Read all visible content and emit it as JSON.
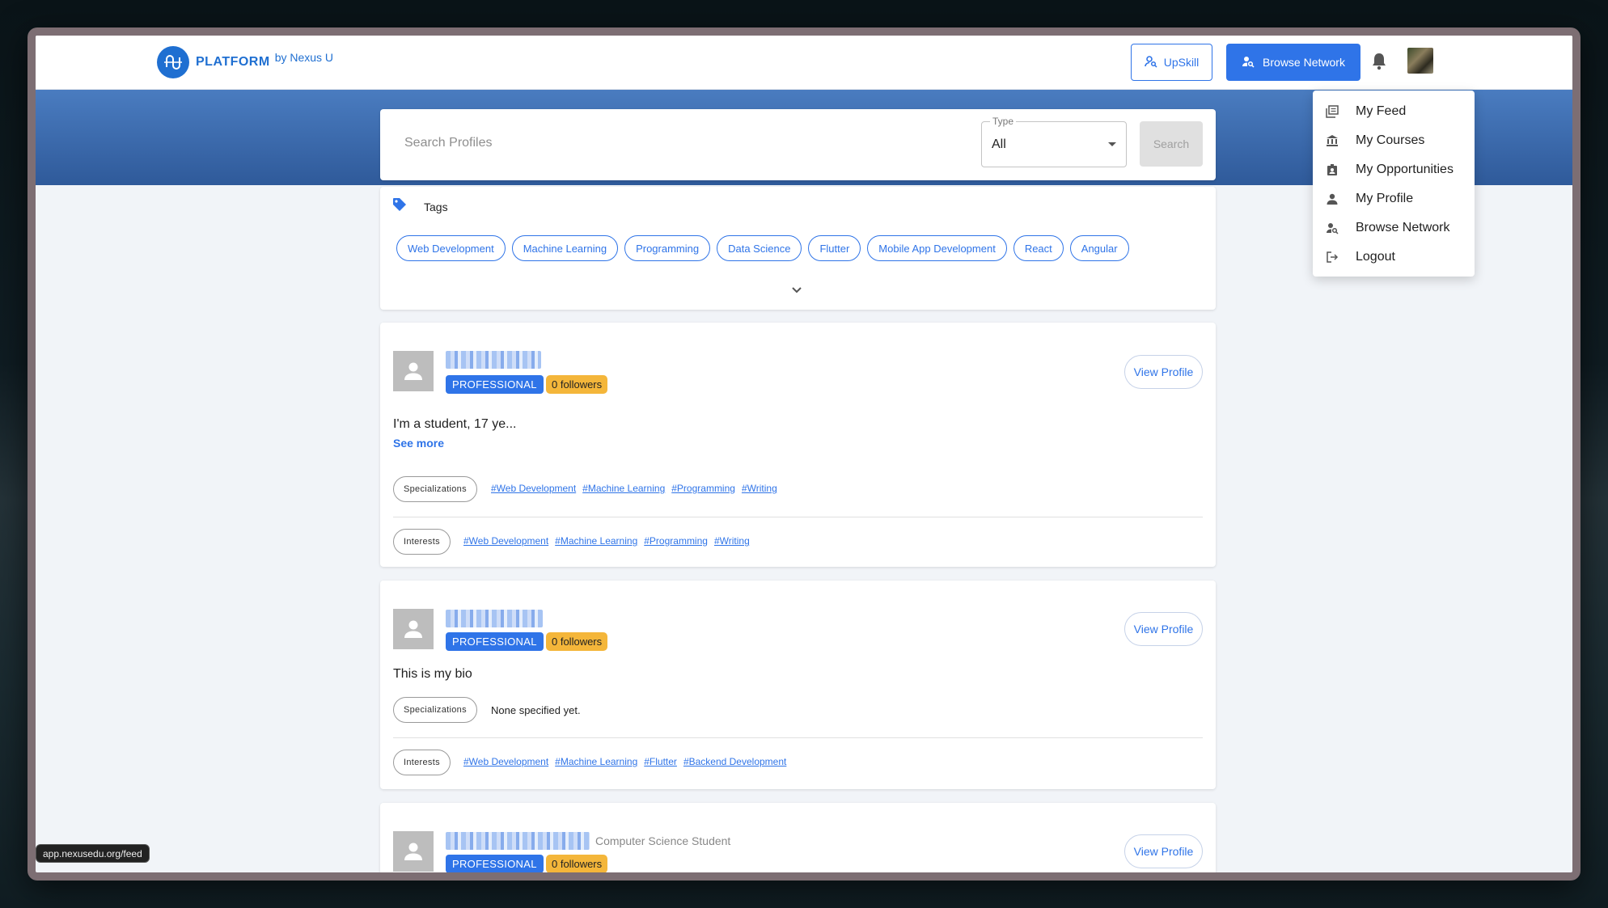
{
  "nav": {
    "logo_text": "PLATFORM",
    "logo_sub": "by Nexus U",
    "upskill_label": "UpSkill",
    "browse_label": "Browse Network"
  },
  "search": {
    "placeholder": "Search Profiles",
    "type_label": "Type",
    "type_value": "All",
    "search_button": "Search"
  },
  "tags": {
    "title": "Tags",
    "items": [
      "Web Development",
      "Machine Learning",
      "Programming",
      "Data Science",
      "Flutter",
      "Mobile App Development",
      "React",
      "Angular"
    ]
  },
  "menu": {
    "items": [
      {
        "label": "My Feed",
        "icon": "feed-icon"
      },
      {
        "label": "My Courses",
        "icon": "institution-icon"
      },
      {
        "label": "My Opportunities",
        "icon": "badge-icon"
      },
      {
        "label": "My Profile",
        "icon": "person-icon"
      },
      {
        "label": "Browse Network",
        "icon": "person-search-icon"
      },
      {
        "label": "Logout",
        "icon": "logout-icon"
      }
    ]
  },
  "profiles": [
    {
      "badge": "PROFESSIONAL",
      "followers": "0 followers",
      "view_label": "View Profile",
      "bio": "I'm a student, 17 ye...",
      "see_more": "See more",
      "specializations_label": "Specializations",
      "specializations": [
        "#Web Development",
        "#Machine Learning",
        "#Programming",
        "#Writing"
      ],
      "interests_label": "Interests",
      "interests": [
        "#Web Development",
        "#Machine Learning",
        "#Programming",
        "#Writing"
      ]
    },
    {
      "badge": "PROFESSIONAL",
      "followers": "0 followers",
      "view_label": "View Profile",
      "bio": "This is my bio",
      "specializations_label": "Specializations",
      "specializations_none": "None specified yet.",
      "interests_label": "Interests",
      "interests": [
        "#Web Development",
        "#Machine Learning",
        "#Flutter",
        "#Backend Development"
      ]
    },
    {
      "subtitle": "Computer Science Student",
      "badge": "PROFESSIONAL",
      "followers": "0 followers",
      "view_label": "View Profile"
    }
  ],
  "status_url": "app.nexusedu.org/feed",
  "colors": {
    "accent": "#2f74e8",
    "hero_top": "#4a7cc0",
    "hero_bottom": "#2f5a9a",
    "followers_badge": "#f4b63a"
  }
}
